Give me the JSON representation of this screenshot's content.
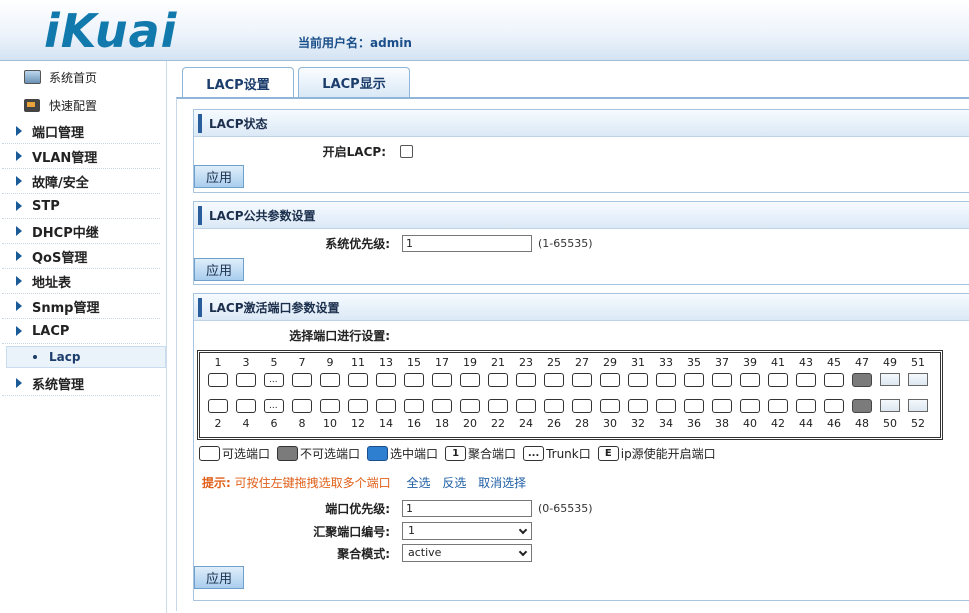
{
  "header": {
    "logo": "iKuai",
    "user_label": "当前用户名：",
    "username": "admin"
  },
  "sidebar": {
    "top": [
      {
        "label": "系统首页",
        "icon": "monitor-icon"
      },
      {
        "label": "快速配置",
        "icon": "wizard-icon"
      }
    ],
    "items": [
      "端口管理",
      "VLAN管理",
      "故障/安全",
      "STP",
      "DHCP中继",
      "QoS管理",
      "地址表",
      "Snmp管理",
      "LACP"
    ],
    "sub_active": "Lacp",
    "bottom": "系统管理"
  },
  "tabs": [
    {
      "label": "LACP设置",
      "active": true
    },
    {
      "label": "LACP显示",
      "active": false
    }
  ],
  "status_section": {
    "title": "LACP状态",
    "enable_label": "开启LACP:",
    "enabled": false,
    "apply": "应用"
  },
  "public_section": {
    "title": "LACP公共参数设置",
    "priority_label": "系统优先级:",
    "priority_value": "1",
    "priority_range": "(1-65535)",
    "apply": "应用"
  },
  "port_section": {
    "title": "LACP激活端口参数设置",
    "select_label": "选择端口进行设置:",
    "top_numbers": [
      "1",
      "3",
      "5",
      "7",
      "9",
      "11",
      "13",
      "15",
      "17",
      "19",
      "21",
      "23",
      "25",
      "27",
      "29",
      "31",
      "33",
      "35",
      "37",
      "39",
      "41",
      "43",
      "45",
      "47",
      "49",
      "51"
    ],
    "bottom_numbers": [
      "2",
      "4",
      "6",
      "8",
      "10",
      "12",
      "14",
      "16",
      "18",
      "20",
      "22",
      "24",
      "26",
      "28",
      "30",
      "32",
      "34",
      "36",
      "38",
      "40",
      "42",
      "44",
      "46",
      "48",
      "50",
      "52"
    ],
    "trunk_ports": [
      "5",
      "6"
    ],
    "disabled_ports": [
      "47",
      "48"
    ],
    "legend": [
      "可选端口",
      "不可选端口",
      "选中端口",
      "聚合端口",
      "Trunk口",
      "ip源使能开启端口"
    ],
    "legend_marks": {
      "aggregate": "1",
      "trunk": "...",
      "ipsource": "E"
    },
    "tip_label": "提示:",
    "tip_text": "可按住左键拖拽选取多个端口",
    "select_all": "全选",
    "invert": "反选",
    "cancel": "取消选择",
    "port_priority_label": "端口优先级:",
    "port_priority_value": "1",
    "port_priority_range": "(0-65535)",
    "agg_label": "汇聚端口编号:",
    "agg_value": "1",
    "mode_label": "聚合模式:",
    "mode_value": "active",
    "apply": "应用"
  },
  "colors": {
    "accent": "#1b4f8a",
    "selected": "#2f7fd0",
    "disabled": "#7b7b7b",
    "tip": "#e0601b"
  }
}
